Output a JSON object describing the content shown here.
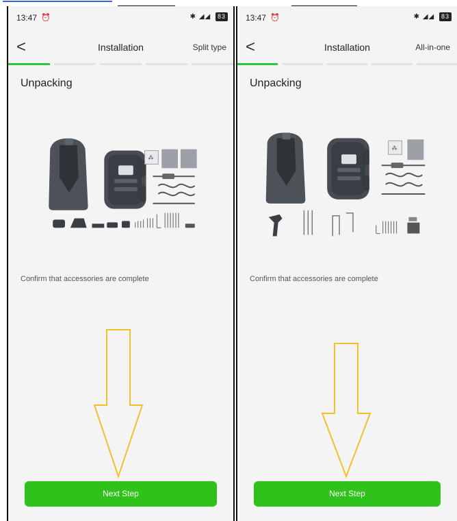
{
  "status_bar": {
    "time": "13:47",
    "battery": "83"
  },
  "panels": [
    {
      "nav": {
        "back": "<",
        "title": "Installation",
        "type_label": "Split type"
      },
      "section_title": "Unpacking",
      "confirm_text": "Confirm that accessories are complete",
      "next_button": "Next Step"
    },
    {
      "nav": {
        "back": "<",
        "title": "Installation",
        "type_label": "All-in-one"
      },
      "section_title": "Unpacking",
      "confirm_text": "Confirm that accessories are complete",
      "next_button": "Next Step"
    }
  ],
  "colors": {
    "accent_green": "#2fc21a",
    "progress_green": "#2bc63b",
    "arrow_yellow": "#f2c02a"
  },
  "icons": [
    "back-chevron-icon",
    "alarm-icon",
    "bluetooth-icon",
    "signal-icon",
    "battery-icon",
    "down-arrow-annotation"
  ]
}
